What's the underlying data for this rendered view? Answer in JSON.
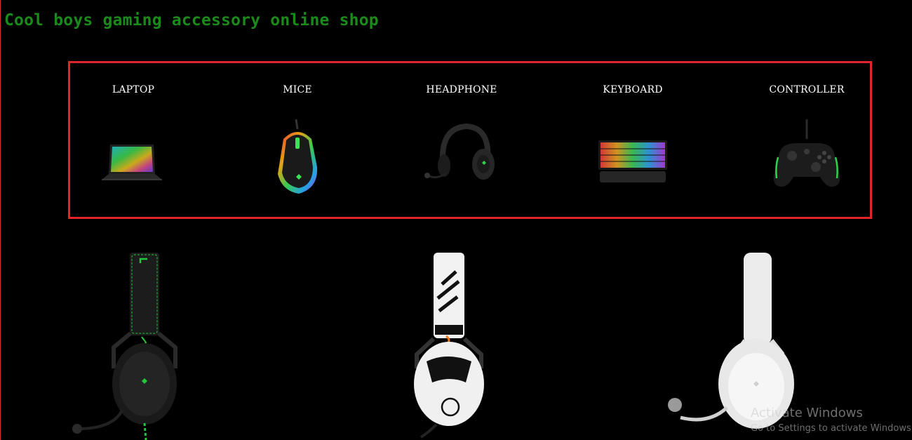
{
  "site": {
    "title": "Cool boys gaming accessory online shop"
  },
  "categories": [
    {
      "label": "LAPTOP",
      "icon": "laptop-icon"
    },
    {
      "label": "MICE",
      "icon": "mouse-icon"
    },
    {
      "label": "HEADPHONE",
      "icon": "headphone-icon"
    },
    {
      "label": "KEYBOARD",
      "icon": "keyboard-icon"
    },
    {
      "label": "CONTROLLER",
      "icon": "controller-icon"
    }
  ],
  "products": [
    {
      "icon": "black-green-headset-icon",
      "color": "#1a1a1a",
      "accent": "#22c93a"
    },
    {
      "icon": "white-siege-headset-icon",
      "color": "#f2f2f2",
      "accent": "#f07a1a"
    },
    {
      "icon": "white-headset-icon",
      "color": "#ececec",
      "accent": "#cfcfcf"
    }
  ],
  "os_overlay": {
    "title": "Activate Windows",
    "subtitle": "Go to Settings to activate Windows."
  },
  "colors": {
    "title_green": "#1a8a1a",
    "box_border": "#e0262b",
    "background": "#000000"
  }
}
